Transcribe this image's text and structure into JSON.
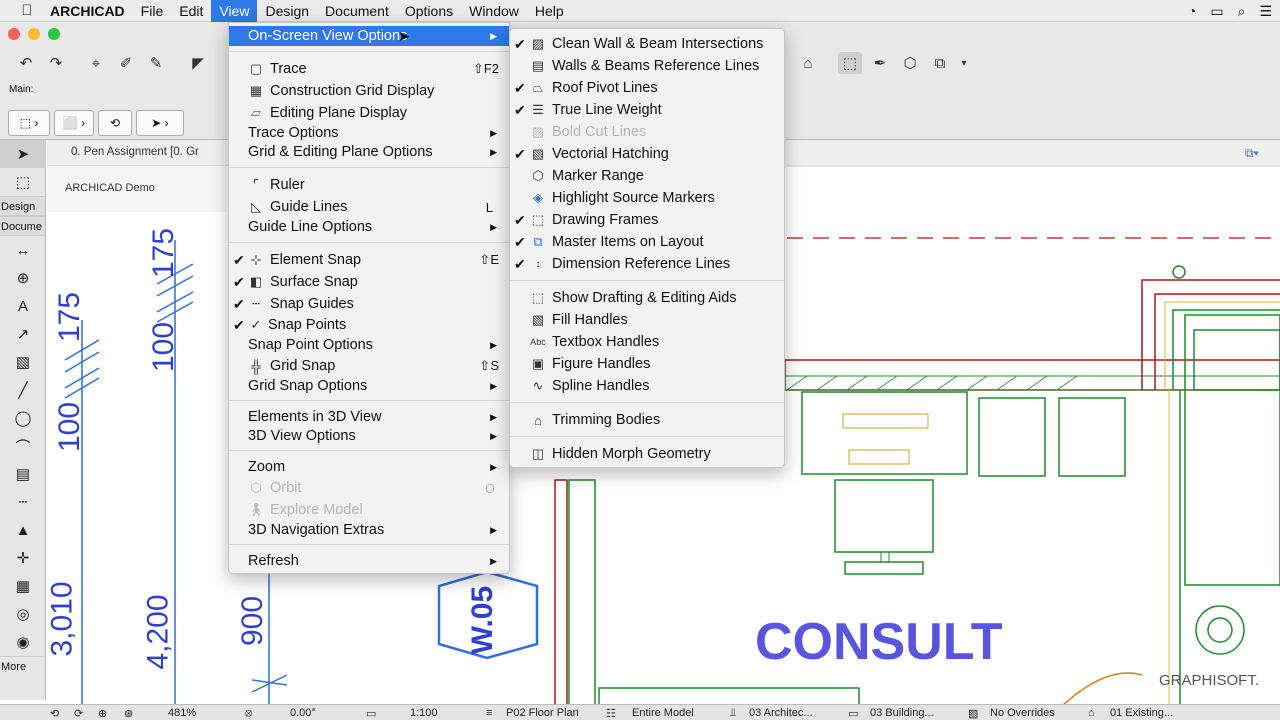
{
  "menubar": {
    "items": [
      "ARCHICAD",
      "File",
      "Edit",
      "View",
      "Design",
      "Document",
      "Options",
      "Window",
      "Help"
    ],
    "active": "View"
  },
  "toolbar": {
    "main_label": "Main:"
  },
  "palette": {
    "design_label": "Design",
    "document_label": "Docume",
    "more_label": "More"
  },
  "canvas": {
    "tab_pen": "0. Pen Assignment [0. Gr",
    "tab_demo": "ARCHICAD Demo",
    "dims_left": [
      "175",
      "100",
      "3,010"
    ],
    "dims_mid": [
      "175",
      "100",
      "4,200"
    ],
    "dims_right": [
      "900"
    ],
    "hex_label": "W.05",
    "consult": "CONSULT",
    "brand": "GRAPHISOFT."
  },
  "view_menu": {
    "items": [
      {
        "label": "On-Screen View Options",
        "highlight": true,
        "submenu": true
      },
      {
        "label": "Trace",
        "shortcut": "⇧F2",
        "icon": "trace-icon"
      },
      {
        "label": "Construction Grid Display",
        "icon": "grid-icon"
      },
      {
        "label": "Editing Plane Display",
        "icon": "plane-icon"
      },
      {
        "label": "Trace Options",
        "submenu": true
      },
      {
        "label": "Grid & Editing Plane Options",
        "submenu": true
      },
      {
        "label": "Ruler",
        "icon": "ruler-icon"
      },
      {
        "label": "Guide Lines",
        "shortcut": "L",
        "icon": "guide-icon"
      },
      {
        "label": "Guide Line Options",
        "submenu": true
      },
      {
        "label": "Element Snap",
        "shortcut": "⇧E",
        "checked": true,
        "icon": "element-snap-icon"
      },
      {
        "label": "Surface Snap",
        "checked": true,
        "icon": "surface-snap-icon"
      },
      {
        "label": "Snap Guides",
        "checked": true,
        "icon": "snap-guides-icon"
      },
      {
        "label": "Snap Points",
        "checked": true,
        "icon": "snap-points-icon"
      },
      {
        "label": "Snap Point Options",
        "submenu": true
      },
      {
        "label": "Grid Snap",
        "shortcut": "⇧S",
        "icon": "grid-snap-icon"
      },
      {
        "label": "Grid Snap Options",
        "submenu": true
      },
      {
        "label": "Elements in 3D View",
        "submenu": true
      },
      {
        "label": "3D View Options",
        "submenu": true
      },
      {
        "label": "Zoom",
        "submenu": true
      },
      {
        "label": "Orbit",
        "shortcut": "O",
        "disabled": true,
        "icon": "orbit-icon"
      },
      {
        "label": "Explore Model",
        "disabled": true,
        "icon": "explore-icon"
      },
      {
        "label": "3D Navigation Extras",
        "submenu": true
      },
      {
        "label": "Refresh",
        "submenu": true
      }
    ]
  },
  "submenu": {
    "items": [
      {
        "label": "Clean Wall & Beam Intersections",
        "checked": true,
        "icon": "clean-wall-icon"
      },
      {
        "label": "Walls & Beams Reference Lines",
        "checked": false,
        "icon": "reference-lines-icon"
      },
      {
        "label": "Roof Pivot Lines",
        "checked": true,
        "icon": "roof-pivot-icon"
      },
      {
        "label": "True Line Weight",
        "checked": true,
        "icon": "line-weight-icon"
      },
      {
        "label": "Bold Cut Lines",
        "disabled": true,
        "icon": "bold-cut-icon"
      },
      {
        "label": "Vectorial Hatching",
        "checked": true,
        "icon": "hatching-icon"
      },
      {
        "label": "Marker Range",
        "icon": "marker-range-icon"
      },
      {
        "label": "Highlight Source Markers",
        "icon": "highlight-source-icon"
      },
      {
        "label": "Drawing Frames",
        "checked": true,
        "icon": "drawing-frames-icon"
      },
      {
        "label": "Master Items on Layout",
        "checked": true,
        "icon": "master-items-icon"
      },
      {
        "label": "Dimension Reference Lines",
        "checked": true,
        "icon": "dimension-ref-icon"
      },
      {
        "label": "Show Drafting & Editing Aids",
        "icon": "drafting-aids-icon"
      },
      {
        "label": "Fill Handles",
        "icon": "fill-handles-icon"
      },
      {
        "label": "Textbox Handles",
        "icon": "textbox-handles-icon"
      },
      {
        "label": "Figure Handles",
        "icon": "figure-handles-icon"
      },
      {
        "label": "Spline Handles",
        "icon": "spline-handles-icon"
      },
      {
        "label": "Trimming Bodies",
        "icon": "trimming-bodies-icon"
      },
      {
        "label": "Hidden Morph Geometry",
        "icon": "morph-icon"
      }
    ]
  },
  "statusbar": {
    "zoom": "481%",
    "angle": "0.00°",
    "scale": "1:100",
    "view": "P02 Floor Plan",
    "model": "Entire Model",
    "layer": "03 Architec...",
    "pen": "03 Building...",
    "overrides": "No Overrides",
    "renovation": "01 Existing..."
  }
}
